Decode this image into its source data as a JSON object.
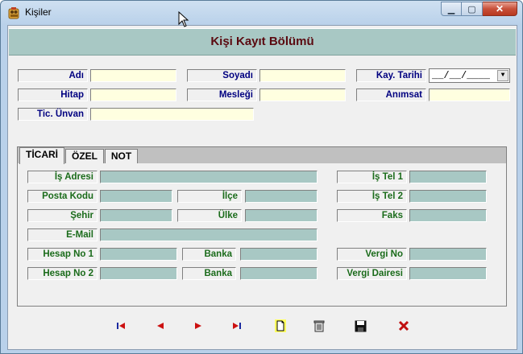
{
  "window": {
    "title": "Kişiler"
  },
  "header": {
    "title": "Kişi Kayıt Bölümü"
  },
  "form": {
    "adi_label": "Adı",
    "soyadi_label": "Soyadı",
    "kay_tarihi_label": "Kay. Tarihi",
    "kay_tarihi_value": "__/__/____",
    "hitap_label": "Hitap",
    "meslegi_label": "Mesleği",
    "animsat_label": "Anımsat",
    "tic_unvan_label": "Tic. Ünvan"
  },
  "tabs": [
    {
      "label": "TİCARİ"
    },
    {
      "label": "ÖZEL"
    },
    {
      "label": "NOT"
    }
  ],
  "ticari": {
    "is_adresi_label": "İş Adresi",
    "posta_kodu_label": "Posta Kodu",
    "ilce_label": "İlçe",
    "sehir_label": "Şehir",
    "ulke_label": "Ülke",
    "email_label": "E-Mail",
    "hesap_no_1_label": "Hesap No 1",
    "banka_1_label": "Banka",
    "hesap_no_2_label": "Hesap No 2",
    "banka_2_label": "Banka",
    "is_tel_1_label": "İş Tel 1",
    "is_tel_2_label": "İş Tel 2",
    "faks_label": "Faks",
    "vergi_no_label": "Vergi No",
    "vergi_dairesi_label": "Vergi Dairesi"
  },
  "toolbar": {
    "icons": [
      "first-record-icon",
      "previous-record-icon",
      "next-record-icon",
      "last-record-icon",
      "new-record-icon",
      "delete-record-icon",
      "save-icon",
      "cancel-icon"
    ]
  },
  "colors": {
    "header_band": "#a8c8c4",
    "header_text": "#5a0a10",
    "label_blue": "#000080",
    "label_green": "#1a6b1a",
    "input_yellow": "#ffffe0",
    "input_teal": "#a8c8c4",
    "nav_red": "#cc1111",
    "nav_blue": "#1a2aa0"
  }
}
